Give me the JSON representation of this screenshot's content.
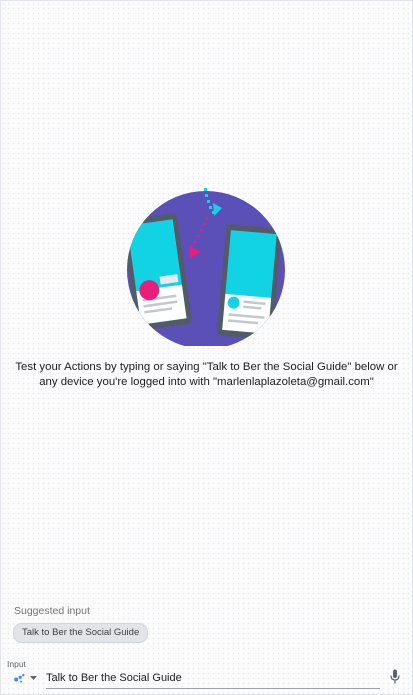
{
  "welcome": {
    "line1": "Test your Actions by typing or saying \"Talk to Ber the Social Guide\" below or",
    "line2": "any device you're logged into with \"marlenlaplazoleta@gmail.com\""
  },
  "suggestions": {
    "label": "Suggested input",
    "chips": [
      "Talk to Ber the Social Guide"
    ]
  },
  "input_bar": {
    "label": "Input",
    "value": "Talk to Ber the Social Guide",
    "mode_icon": "assistant-dots-icon",
    "dropdown_icon": "chevron-down-icon",
    "mic_icon": "microphone-icon"
  },
  "colors": {
    "circle": "#5b4fb8",
    "phone": "#555a6b",
    "screen": "#12d3e4",
    "card": "#ffffff",
    "accent_pink": "#e91e7a",
    "accent_cyan": "#12d3e4",
    "assistant_blue": "#4285f4"
  }
}
